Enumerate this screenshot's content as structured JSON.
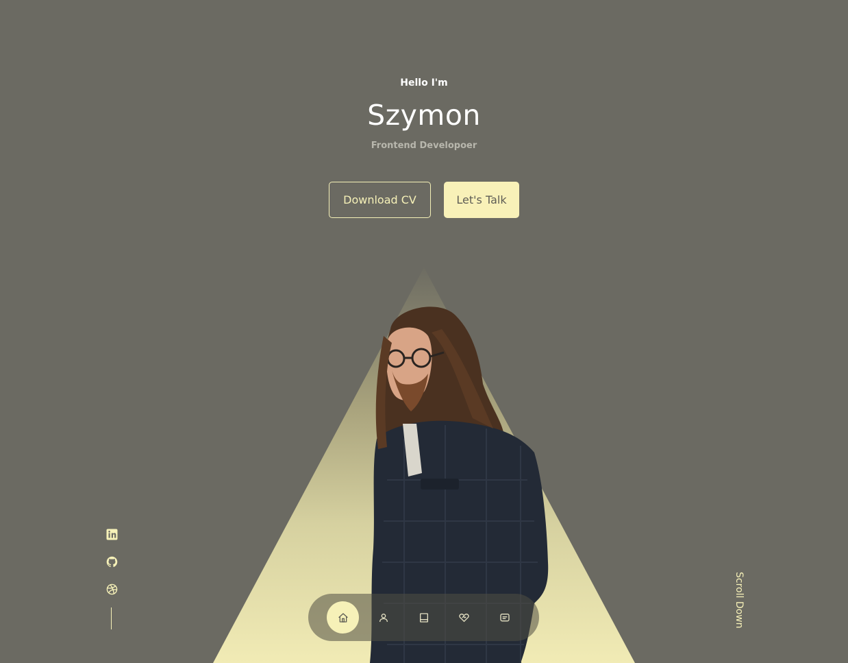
{
  "hero": {
    "greeting": "Hello I'm",
    "name": "Szymon",
    "role": "Frontend Developoer"
  },
  "buttons": {
    "download_cv": "Download CV",
    "lets_talk": "Let's Talk"
  },
  "socials": [
    {
      "name": "linkedin-icon"
    },
    {
      "name": "github-icon"
    },
    {
      "name": "dribbble-icon"
    }
  ],
  "scroll": {
    "label": "Scroll Down"
  },
  "nav": {
    "items": [
      {
        "icon": "home-icon",
        "active": true
      },
      {
        "icon": "user-icon",
        "active": false
      },
      {
        "icon": "book-icon",
        "active": false
      },
      {
        "icon": "services-icon",
        "active": false
      },
      {
        "icon": "message-icon",
        "active": false
      }
    ]
  },
  "colors": {
    "background": "#6b6a62",
    "accent": "#f6f1b8",
    "text": "#ffffff",
    "muted": "#b8b7ad"
  }
}
